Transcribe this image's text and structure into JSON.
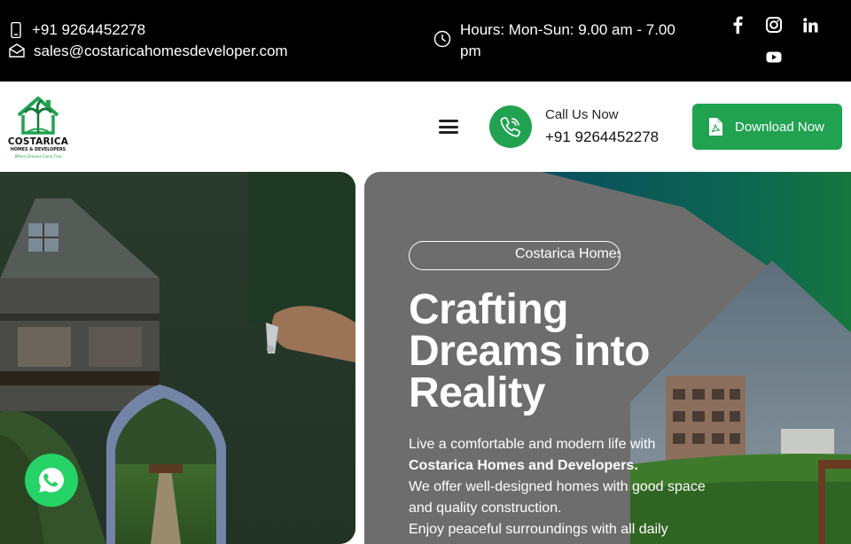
{
  "topbar": {
    "phone": "+91 9264452278",
    "email": "sales@costaricahomesdeveloper.com",
    "hours_line1": "Hours: Mon-Sun: 9.00 am - 7.00",
    "hours_line2": "pm"
  },
  "social": [
    "facebook-icon",
    "instagram-icon",
    "linkedin-icon",
    "youtube-icon"
  ],
  "logo": {
    "name": "COSTARICA",
    "sub": "HOMES & DEVELOPERS",
    "tagline": "Where Dreams Come True"
  },
  "header": {
    "call_label": "Call Us Now",
    "call_number": "+91 9264452278",
    "download_label": "Download Now"
  },
  "hero": {
    "pill_text": "Costarica Homes",
    "headline_1": "Crafting",
    "headline_2": "Dreams into",
    "headline_3": "Reality",
    "desc_1": "Live a comfortable and modern life with",
    "desc_brand": "Costarica Homes and Developers.",
    "desc_2": "We offer well-designed homes with good space",
    "desc_3": "and quality construction.",
    "desc_4": "Enjoy peaceful surroundings with all daily"
  },
  "colors": {
    "brand_green": "#21a251",
    "whatsapp_green": "#25d366",
    "topbar_bg": "#000000"
  }
}
